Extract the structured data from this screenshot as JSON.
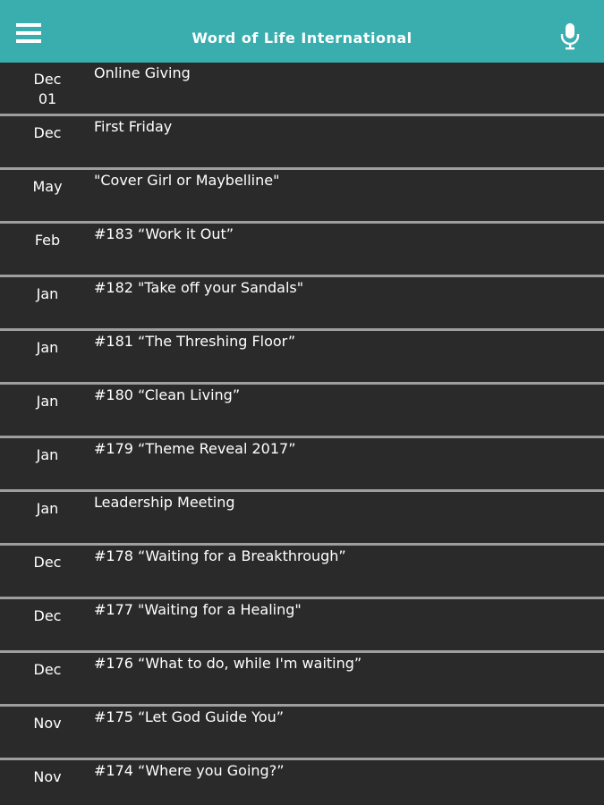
{
  "header": {
    "title": "Word of Life International",
    "menu_icon": "hamburger-menu-icon",
    "mic_icon": "microphone-icon",
    "background_color": "#3aaeae"
  },
  "items": [
    {
      "date": "Dec\n01",
      "title": "Online Giving"
    },
    {
      "date": "Dec",
      "title": "First Friday"
    },
    {
      "date": "May",
      "title": "\"Cover Girl or Maybelline\""
    },
    {
      "date": "Feb",
      "title": "#183 “Work it Out”"
    },
    {
      "date": "Jan",
      "title": "#182 \"Take off your Sandals\""
    },
    {
      "date": "Jan",
      "title": "#181 “The Threshing Floor”"
    },
    {
      "date": "Jan",
      "title": "#180 “Clean Living”"
    },
    {
      "date": "Jan",
      "title": "#179 “Theme Reveal 2017”"
    },
    {
      "date": "Jan",
      "title": "Leadership Meeting"
    },
    {
      "date": "Dec",
      "title": "#178 “Waiting for a Breakthrough”"
    },
    {
      "date": "Dec",
      "title": "#177 \"Waiting for a Healing\""
    },
    {
      "date": "Dec",
      "title": "#176 “What to do, while I'm waiting”"
    },
    {
      "date": "Nov",
      "title": "#175 “Let God Guide You”"
    },
    {
      "date": "Nov",
      "title": "#174 “Where you Going?”"
    }
  ]
}
